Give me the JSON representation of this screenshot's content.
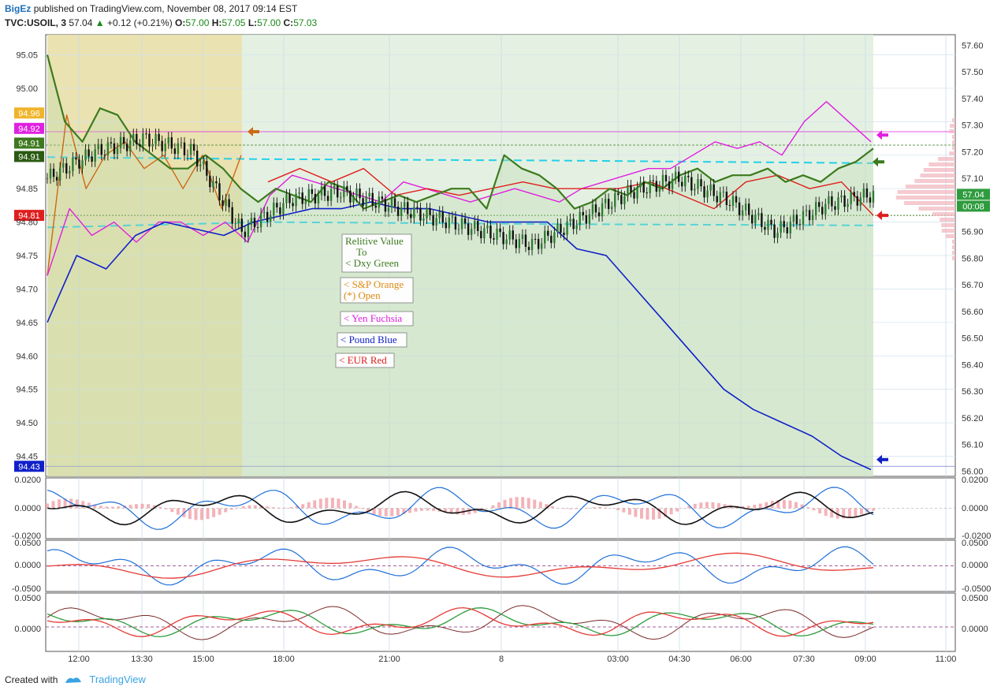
{
  "header": {
    "author": "BigEz",
    "published": "published on TradingView.com, November 08, 2017 09:14 EST",
    "symbol": "TVC:USOIL, 3",
    "last": "57.04",
    "change": "+0.12 (+0.21%)",
    "o_label": "O:",
    "o": "57.00",
    "h_label": "H:",
    "h": "57.05",
    "l_label": "L:",
    "l": "57.00",
    "c_label": "C:",
    "c": "57.03"
  },
  "footer": {
    "created_with": "Created with",
    "brand": "TradingView"
  },
  "colors": {
    "dxy": "#3d7a1e",
    "sp": "#cc6a14",
    "yen": "#e020e0",
    "pound": "#1020c8",
    "eur": "#e01e1e",
    "price": "#111111",
    "guide": "#22d0e8",
    "session_pre": "#e8dfa8",
    "session_main": "#dfeedd"
  },
  "chart_data": [
    {
      "type": "line",
      "title": "",
      "left_axis": {
        "ticks": [
          "95.05",
          "95.00",
          "94.96",
          "94.92",
          "94.91",
          "94.91",
          "94.85",
          "94.81",
          "94.80",
          "94.75",
          "94.70",
          "94.65",
          "94.60",
          "94.55",
          "94.50",
          "94.45",
          "94.43"
        ],
        "range": [
          94.42,
          95.08
        ]
      },
      "right_axis": {
        "ticks": [
          "57.60",
          "57.50",
          "57.40",
          "57.30",
          "57.20",
          "57.10",
          "57.04",
          "00:08",
          "56.90",
          "56.80",
          "56.70",
          "56.60",
          "56.50",
          "56.40",
          "56.30",
          "56.20",
          "56.10",
          "56.00"
        ],
        "range": [
          55.98,
          57.64
        ]
      },
      "x_ticks": [
        "12:00",
        "13:30",
        "15:00",
        "18:00",
        "21:00",
        "8",
        "03:00",
        "04:30",
        "06:00",
        "07:30",
        "09:00",
        "11:00"
      ],
      "price_badges": [
        {
          "label": "94.96",
          "color": "#f0b429"
        },
        {
          "label": "94.92",
          "color": "#e020e0"
        },
        {
          "label": "94.91",
          "color": "#3d7a1e"
        },
        {
          "label": "94.91",
          "color": "#2a5a12"
        },
        {
          "label": "94.81",
          "color": "#e01e1e"
        },
        {
          "label": "94.43",
          "color": "#1020c8"
        },
        {
          "label": "57.04",
          "color": "#2e9c3e"
        },
        {
          "label": "00:08",
          "color": "#2e9c3e"
        }
      ],
      "legend_notes": [
        {
          "lines": [
            "Relitive Value",
            "To",
            "< Dxy Green"
          ],
          "color": "#3d7a1e"
        },
        {
          "lines": [
            "< S&P Orange",
            "(*) Open"
          ],
          "color": "#e08a14"
        },
        {
          "lines": [
            "< Yen Fuchsia"
          ],
          "color": "#e020e0"
        },
        {
          "lines": [
            "< Pound Blue"
          ],
          "color": "#1020c8"
        },
        {
          "lines": [
            "< EUR Red"
          ],
          "color": "#e01e1e"
        }
      ],
      "series": [
        {
          "name": "Dxy Green",
          "values": [
            95.05,
            94.95,
            94.92,
            94.97,
            94.96,
            94.92,
            94.9,
            94.88,
            94.88,
            94.9,
            94.88,
            94.85,
            94.83,
            94.85,
            94.84,
            94.83,
            94.86,
            94.85,
            94.82,
            94.83,
            94.84,
            94.83,
            94.84,
            94.85,
            94.85,
            94.82,
            94.9,
            94.88,
            94.87,
            94.85,
            94.82,
            94.83,
            94.85,
            94.84,
            94.86,
            94.85,
            94.87,
            94.88,
            94.86,
            94.87,
            94.87,
            94.88,
            94.86,
            94.87,
            94.86,
            94.88,
            94.89,
            94.91
          ]
        },
        {
          "name": "S&P Orange",
          "values": [
            94.72,
            94.96,
            94.85,
            94.9,
            94.92,
            94.88,
            94.9,
            94.85,
            94.9,
            94.82,
            94.9
          ]
        },
        {
          "name": "Yen Fuchsia",
          "values": [
            94.72,
            94.82,
            94.78,
            94.8,
            94.77,
            94.8,
            94.8,
            94.78,
            94.8,
            94.77,
            94.84,
            94.87,
            94.86,
            94.85,
            94.84,
            94.83,
            94.86,
            94.85,
            94.84,
            94.83,
            94.84,
            94.85,
            94.84,
            94.83,
            94.85,
            94.86,
            94.87,
            94.88,
            94.88,
            94.9,
            94.92,
            94.91,
            94.92,
            94.9,
            94.95,
            94.98,
            94.95,
            94.92
          ]
        },
        {
          "name": "Pound Blue",
          "values": [
            94.65,
            94.75,
            94.73,
            94.78,
            94.8,
            94.79,
            94.78,
            94.8,
            94.81,
            94.82,
            94.82,
            94.83,
            94.82,
            94.82,
            94.81,
            94.8,
            94.8,
            94.8,
            94.76,
            94.75,
            94.7,
            94.65,
            94.6,
            94.55,
            94.52,
            94.5,
            94.48,
            94.45,
            94.43
          ]
        },
        {
          "name": "EUR Red",
          "values": [
            94.86,
            94.88,
            94.86,
            94.88,
            94.84,
            94.85,
            94.84,
            94.85,
            94.86,
            94.85,
            94.85,
            94.85,
            94.86,
            94.84,
            94.82,
            94.86,
            94.87,
            94.85,
            94.86,
            94.81
          ]
        },
        {
          "name": "USOIL 3",
          "values": [
            57.1,
            57.2,
            57.25,
            57.2,
            56.9,
            57.02,
            57.05,
            57.0,
            56.95,
            56.9,
            56.85,
            56.95,
            57.05,
            57.1,
            57.02,
            56.9,
            57.0,
            57.04
          ]
        }
      ]
    },
    {
      "type": "area",
      "title": "",
      "y_ticks": [
        "0.0200",
        "0.0000",
        "-0.0200"
      ]
    },
    {
      "type": "line",
      "title": "",
      "y_ticks": [
        "0.0500",
        "0.0000",
        "-0.0500"
      ]
    },
    {
      "type": "line",
      "title": "",
      "y_ticks": [
        "0.0500",
        "0.0000"
      ]
    }
  ]
}
